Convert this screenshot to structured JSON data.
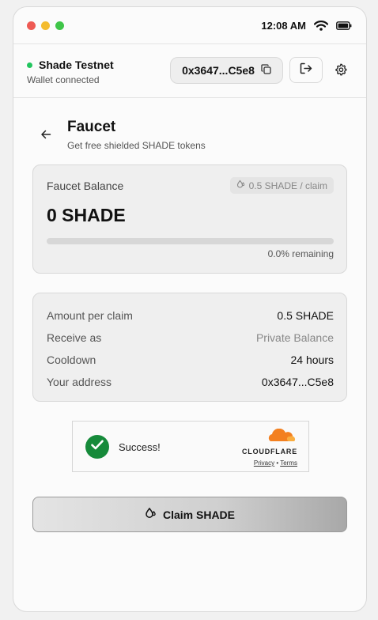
{
  "status_bar": {
    "time": "12:08 AM"
  },
  "header": {
    "network_name": "Shade Testnet",
    "connection_status": "Wallet connected",
    "address_short": "0x3647...C5e8",
    "status_color": "#22c55e"
  },
  "page": {
    "title": "Faucet",
    "subtitle": "Get free shielded SHADE tokens"
  },
  "balance_card": {
    "label": "Faucet Balance",
    "rate": "0.5 SHADE / claim",
    "balance": "0 SHADE",
    "remaining_fraction": 0.0,
    "remaining_text": "0.0% remaining"
  },
  "details": [
    {
      "label": "Amount per claim",
      "value": "0.5 SHADE"
    },
    {
      "label": "Receive as",
      "value": "Private Balance"
    },
    {
      "label": "Cooldown",
      "value": "24 hours"
    },
    {
      "label": "Your address",
      "value": "0x3647...C5e8"
    }
  ],
  "captcha": {
    "status": "Success!",
    "brand": "CLOUDFLARE",
    "privacy": "Privacy",
    "separator": "•",
    "terms": "Terms"
  },
  "claim_button": {
    "label": "Claim SHADE"
  },
  "icons": {
    "copy": "copy-icon",
    "logout": "logout-icon",
    "settings": "gear-icon",
    "back": "arrow-left-icon",
    "drop": "droplet-icon",
    "check": "check-icon",
    "wifi": "wifi-icon",
    "battery": "battery-icon"
  }
}
